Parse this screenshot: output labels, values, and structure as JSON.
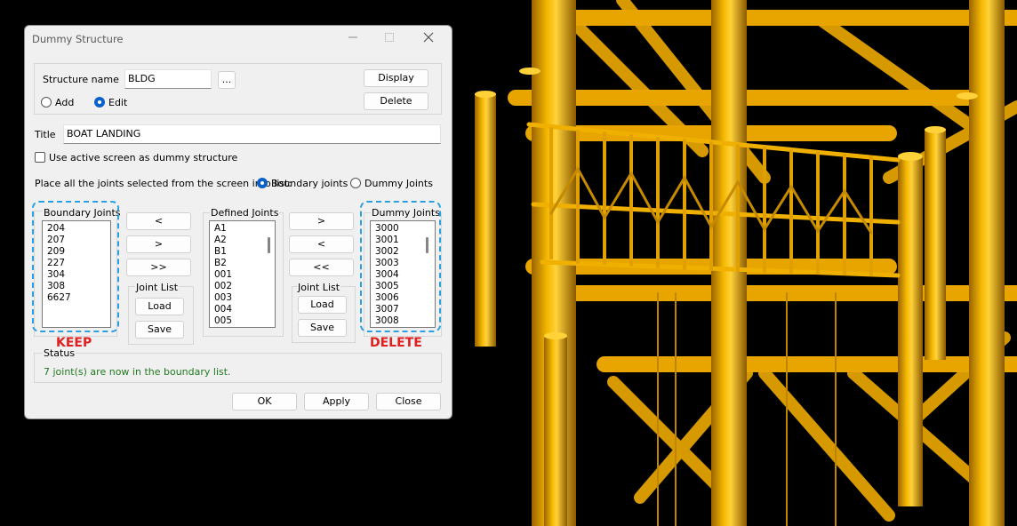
{
  "window": {
    "title": "Dummy Structure"
  },
  "structure": {
    "name_label": "Structure name",
    "name_value": "BLDG",
    "browse_label": "...",
    "display_label": "Display",
    "delete_label": "Delete",
    "add_label": "Add",
    "edit_label": "Edit",
    "mode": "Edit"
  },
  "title_field": {
    "label": "Title",
    "value": "BOAT LANDING"
  },
  "use_active": {
    "label": "Use active screen as dummy structure",
    "checked": false
  },
  "place": {
    "label": "Place all the joints selected from the screen into list:",
    "boundary_label": "Boundary joints",
    "dummy_label": "Dummy Joints",
    "selected": "Boundary joints"
  },
  "boundary": {
    "title": "Boundary Joints",
    "items": [
      "204",
      "207",
      "209",
      "227",
      "304",
      "308",
      "6627"
    ],
    "annotation": "KEEP"
  },
  "left_transfer": {
    "btn1": "<",
    "btn2": ">",
    "btn3": ">>"
  },
  "left_joint_list": {
    "title": "Joint List",
    "load": "Load",
    "save": "Save"
  },
  "defined": {
    "title": "Defined Joints",
    "items": [
      "A1",
      "A2",
      "B1",
      "B2",
      "001",
      "002",
      "003",
      "004",
      "005"
    ]
  },
  "right_transfer": {
    "btn1": ">",
    "btn2": "<",
    "btn3": "<<"
  },
  "right_joint_list": {
    "title": "Joint List",
    "load": "Load",
    "save": "Save"
  },
  "dummy": {
    "title": "Dummy Joints",
    "items": [
      "3000",
      "3001",
      "3002",
      "3003",
      "3004",
      "3005",
      "3006",
      "3007",
      "3008"
    ],
    "annotation": "DELETE"
  },
  "status": {
    "title": "Status",
    "text": "7 joint(s) are now in the boundary list."
  },
  "footer": {
    "ok": "OK",
    "apply": "Apply",
    "close": "Close"
  },
  "colors": {
    "structure": "#e8a500",
    "highlight": "#2ba0e0",
    "annotation": "#e02020",
    "status_text": "#217a21"
  }
}
